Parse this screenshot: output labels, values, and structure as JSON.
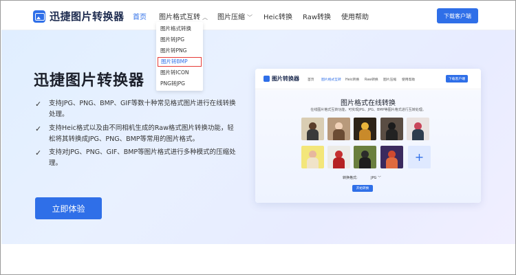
{
  "header": {
    "logo_text": "迅捷图片转换器",
    "nav": [
      {
        "label": "首页",
        "active": true,
        "dropdown": false
      },
      {
        "label": "图片格式互转",
        "active": false,
        "dropdown": true
      },
      {
        "label": "图片压缩",
        "active": false,
        "dropdown": true
      },
      {
        "label": "Heic转换",
        "active": false,
        "dropdown": false
      },
      {
        "label": "Raw转换",
        "active": false,
        "dropdown": false
      },
      {
        "label": "使用帮助",
        "active": false,
        "dropdown": false
      }
    ],
    "download_button": "下载客户端"
  },
  "dropdown": {
    "items": [
      "图片格式转换",
      "图片转JPG",
      "图片转PNG",
      "图片转BMP",
      "图片转ICON",
      "PNG转JPG"
    ],
    "highlighted_index": 3
  },
  "hero": {
    "title": "迅捷图片转换器",
    "features": [
      "支持JPG、PNG、BMP、GIF等数十种常见格式图片进行在线转换处理。",
      "支持Heic格式以及由不同相机生成的Raw格式图片转换功能，轻松将其转换成JPG、PNG、BMP等常用的图片格式。",
      "支持对JPG、PNG、GIF、BMP等图片格式进行多种模式的压缩处理。"
    ],
    "cta": "立即体验"
  },
  "preview": {
    "logo_text": "图片转换器",
    "nav": [
      "首页",
      "图片格式互转",
      "Heic转换",
      "Raw转换",
      "图片压缩",
      "使用帮助"
    ],
    "active_nav_index": 1,
    "download_button": "下载客户端",
    "title": "图片格式在线转换",
    "subtitle": "在线图片格式互转功能，可实现JPG、JPG、BMP等图片格式进行互转处理。",
    "format_label": "转换格式:",
    "format_value": "JPG",
    "start_button": "开始转换",
    "add_icon": "plus-icon"
  },
  "colors": {
    "accent": "#2f6fe8",
    "highlight_border": "#e53935"
  }
}
